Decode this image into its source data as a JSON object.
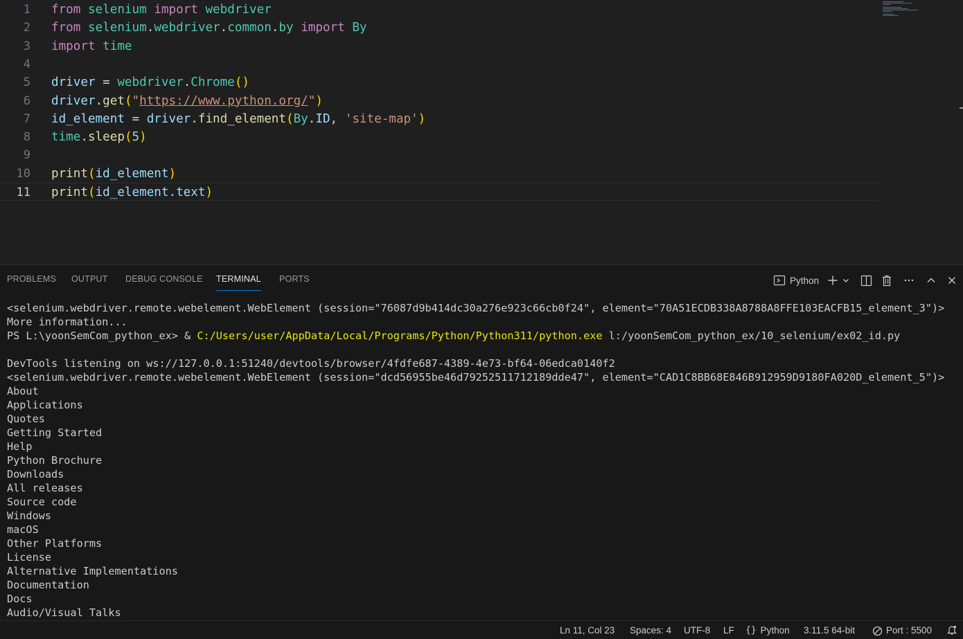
{
  "editor": {
    "line_numbers": [
      "1",
      "2",
      "3",
      "4",
      "5",
      "6",
      "7",
      "8",
      "9",
      "10",
      "11"
    ],
    "current_line": "11",
    "lines": [
      [
        {
          "t": "from",
          "c": "kw"
        },
        {
          "t": " "
        },
        {
          "t": "selenium",
          "c": "mod"
        },
        {
          "t": " "
        },
        {
          "t": "import",
          "c": "kw"
        },
        {
          "t": " "
        },
        {
          "t": "webdriver",
          "c": "mod"
        }
      ],
      [
        {
          "t": "from",
          "c": "kw"
        },
        {
          "t": " "
        },
        {
          "t": "selenium",
          "c": "mod"
        },
        {
          "t": ".",
          "c": "op"
        },
        {
          "t": "webdriver",
          "c": "mod"
        },
        {
          "t": ".",
          "c": "op"
        },
        {
          "t": "common",
          "c": "mod"
        },
        {
          "t": ".",
          "c": "op"
        },
        {
          "t": "by",
          "c": "mod"
        },
        {
          "t": " "
        },
        {
          "t": "import",
          "c": "kw"
        },
        {
          "t": " "
        },
        {
          "t": "By",
          "c": "mod"
        }
      ],
      [
        {
          "t": "import",
          "c": "kw"
        },
        {
          "t": " "
        },
        {
          "t": "time",
          "c": "mod"
        }
      ],
      [],
      [
        {
          "t": "driver",
          "c": "var"
        },
        {
          "t": " = ",
          "c": "op"
        },
        {
          "t": "webdriver",
          "c": "mod"
        },
        {
          "t": ".",
          "c": "op"
        },
        {
          "t": "Chrome",
          "c": "mod"
        },
        {
          "t": "()",
          "c": "p1"
        }
      ],
      [
        {
          "t": "driver",
          "c": "var"
        },
        {
          "t": ".",
          "c": "op"
        },
        {
          "t": "get",
          "c": "fn"
        },
        {
          "t": "(",
          "c": "p1"
        },
        {
          "t": "\"",
          "c": "str"
        },
        {
          "t": "https://www.python.org/",
          "c": "url"
        },
        {
          "t": "\"",
          "c": "str"
        },
        {
          "t": ")",
          "c": "p1"
        }
      ],
      [
        {
          "t": "id_element",
          "c": "var"
        },
        {
          "t": " = ",
          "c": "op"
        },
        {
          "t": "driver",
          "c": "var"
        },
        {
          "t": ".",
          "c": "op"
        },
        {
          "t": "find_element",
          "c": "fn"
        },
        {
          "t": "(",
          "c": "p1"
        },
        {
          "t": "By",
          "c": "mod"
        },
        {
          "t": ".",
          "c": "op"
        },
        {
          "t": "ID",
          "c": "var"
        },
        {
          "t": ", ",
          "c": "op"
        },
        {
          "t": "'site-map'",
          "c": "str"
        },
        {
          "t": ")",
          "c": "p1"
        }
      ],
      [
        {
          "t": "time",
          "c": "mod"
        },
        {
          "t": ".",
          "c": "op"
        },
        {
          "t": "sleep",
          "c": "fn"
        },
        {
          "t": "(",
          "c": "p1"
        },
        {
          "t": "5",
          "c": "num"
        },
        {
          "t": ")",
          "c": "p1"
        }
      ],
      [],
      [
        {
          "t": "print",
          "c": "fn"
        },
        {
          "t": "(",
          "c": "p1"
        },
        {
          "t": "id_element",
          "c": "var"
        },
        {
          "t": ")",
          "c": "p1"
        }
      ],
      [
        {
          "t": "print",
          "c": "fn"
        },
        {
          "t": "(",
          "c": "p1"
        },
        {
          "t": "id_element",
          "c": "var"
        },
        {
          "t": ".",
          "c": "op"
        },
        {
          "t": "text",
          "c": "var"
        },
        {
          "t": ")",
          "c": "p1"
        }
      ]
    ]
  },
  "panel": {
    "tabs": [
      {
        "label": "PROBLEMS",
        "active": false
      },
      {
        "label": "OUTPUT",
        "active": false
      },
      {
        "label": "DEBUG CONSOLE",
        "active": false
      },
      {
        "label": "TERMINAL",
        "active": true
      },
      {
        "label": "PORTS",
        "active": false
      }
    ],
    "shell_label": "Python",
    "icons": {
      "terminal": "terminal-icon",
      "new_terminal": "plus-icon",
      "dropdown": "chevron-down-icon",
      "split": "split-terminal-icon",
      "kill": "trash-icon",
      "more": "more-actions-icon",
      "maximize": "chevron-up-icon",
      "close": "close-icon"
    }
  },
  "terminal": {
    "lines": [
      [
        {
          "t": "<selenium.webdriver.remote.webelement.WebElement (session=\"76087d9b414dc30a276e923c66cb0f24\", element=\"70A51ECDB338A8788A8FFE103EACFB15_element_3\")>"
        }
      ],
      [
        {
          "t": "More information..."
        }
      ],
      [
        {
          "t": "PS L:\\yoonSemCom_python_ex> & "
        },
        {
          "t": "C:/Users/user/AppData/Local/Programs/Python/Python311/python.exe",
          "c": "yellow"
        },
        {
          "t": " l:/yoonSemCom_python_ex/10_selenium/ex02_id.py"
        }
      ],
      [
        {
          "t": ""
        }
      ],
      [
        {
          "t": "DevTools listening on ws://127.0.0.1:51240/devtools/browser/4fdfe687-4389-4e73-bf64-06edca0140f2"
        }
      ],
      [
        {
          "t": "<selenium.webdriver.remote.webelement.WebElement (session=\"dcd56955be46d79252511712189dde47\", element=\"CAD1C8BB68E846B912959D9180FA020D_element_5\")>"
        }
      ],
      [
        {
          "t": "About"
        }
      ],
      [
        {
          "t": "Applications"
        }
      ],
      [
        {
          "t": "Quotes"
        }
      ],
      [
        {
          "t": "Getting Started"
        }
      ],
      [
        {
          "t": "Help"
        }
      ],
      [
        {
          "t": "Python Brochure"
        }
      ],
      [
        {
          "t": "Downloads"
        }
      ],
      [
        {
          "t": "All releases"
        }
      ],
      [
        {
          "t": "Source code"
        }
      ],
      [
        {
          "t": "Windows"
        }
      ],
      [
        {
          "t": "macOS"
        }
      ],
      [
        {
          "t": "Other Platforms"
        }
      ],
      [
        {
          "t": "License"
        }
      ],
      [
        {
          "t": "Alternative Implementations"
        }
      ],
      [
        {
          "t": "Documentation"
        }
      ],
      [
        {
          "t": "Docs"
        }
      ],
      [
        {
          "t": "Audio/Visual Talks"
        }
      ]
    ]
  },
  "statusbar": {
    "position": "Ln 11, Col 23",
    "spaces": "Spaces: 4",
    "encoding": "UTF-8",
    "eol": "LF",
    "language": "Python",
    "interpreter": "3.11.5 64-bit",
    "port": "Port : 5500",
    "icons": {
      "language": "braces-icon",
      "port": "no-entry-icon",
      "notifications": "bell-icon"
    }
  }
}
